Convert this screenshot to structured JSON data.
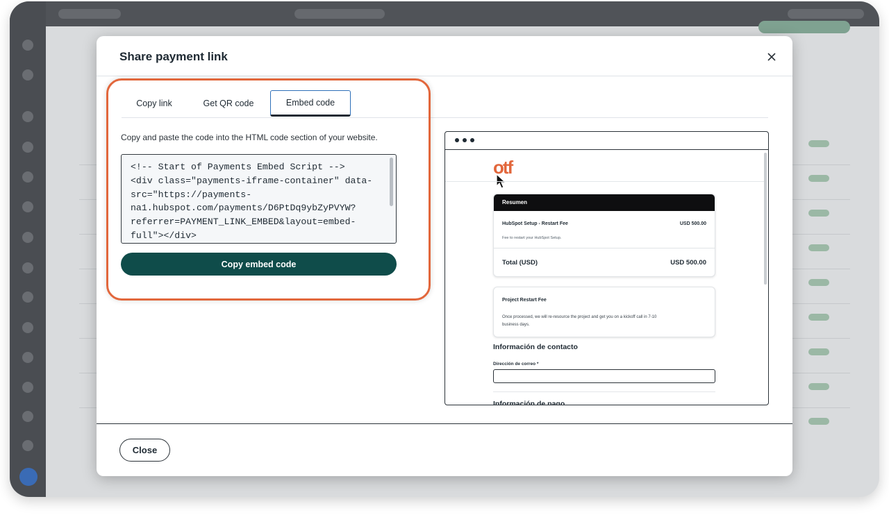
{
  "modal": {
    "title": "Share payment link",
    "close_label": "Close"
  },
  "tabs": [
    {
      "label": "Copy link"
    },
    {
      "label": "Get QR code"
    },
    {
      "label": "Embed code",
      "active": true
    }
  ],
  "embed": {
    "instructions": "Copy and paste the code into the HTML code section of your website.",
    "code": "<!-- Start of Payments Embed Script -->\n<div class=\"payments-iframe-container\" data-\nsrc=\"https://payments-\nna1.hubspot.com/payments/D6PtDq9ybZyPVYW?\nreferrer=PAYMENT_LINK_EMBED&layout=embed-\nfull\"></div>",
    "copy_button": "Copy embed code"
  },
  "preview": {
    "logo": "otf",
    "summary": {
      "header": "Resumen",
      "item_name": "HubSpot Setup - Restart Fee",
      "item_amount": "USD 500.00",
      "item_desc": "Fee to restart your HubSpot Setup.",
      "total_label": "Total (USD)",
      "total_value": "USD 500.00"
    },
    "project": {
      "title": "Project Restart Fee",
      "description": "Once processed, we will re-resource the project and get you on a kickoff call in 7-10 business days."
    },
    "contact_heading": "Información de contacto",
    "email_label": "Dirección de correo *",
    "payment_heading": "Información de pago"
  },
  "colors": {
    "accent_orange": "#e2673c",
    "primary_button": "#0f4c4a",
    "active_tab_border": "#2e6fb8"
  },
  "icons": [
    "close-icon",
    "cursor-arrow-icon",
    "window-dots-icon"
  ]
}
